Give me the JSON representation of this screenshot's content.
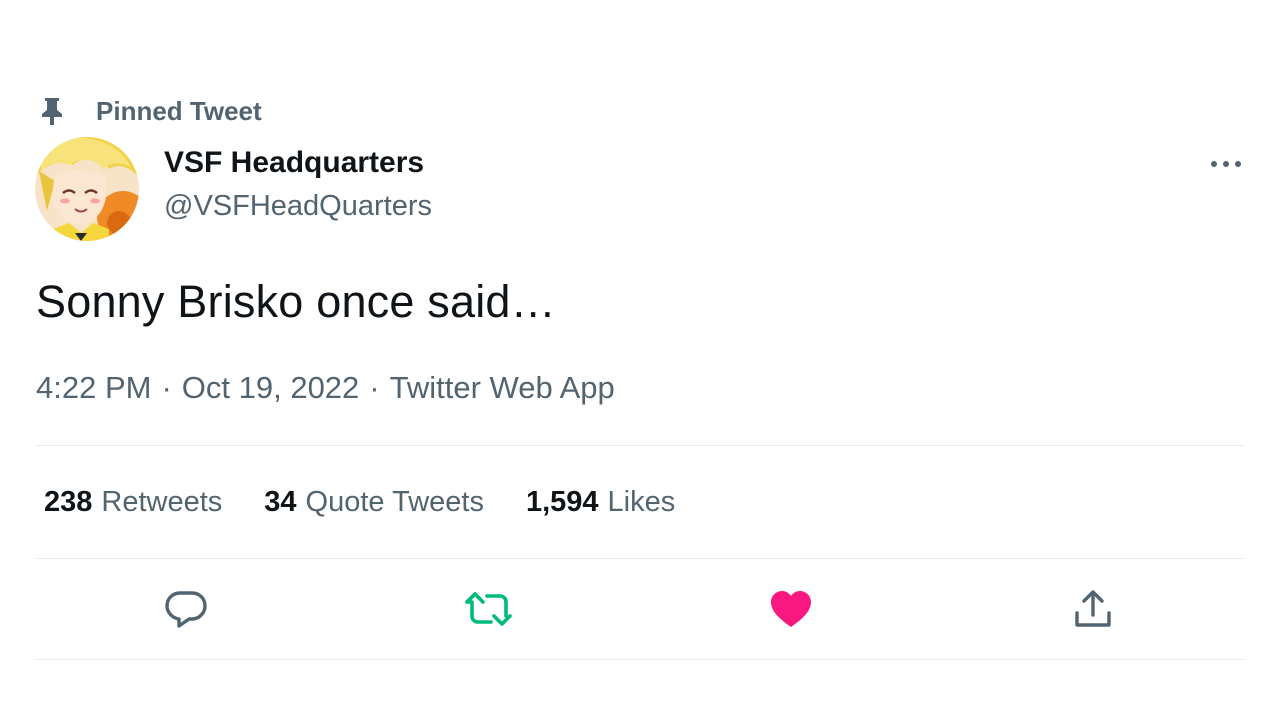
{
  "pinned": {
    "icon": "pin-icon",
    "label": "Pinned Tweet"
  },
  "author": {
    "display_name": "VSF Headquarters",
    "handle": "@VSFHeadQuarters",
    "avatar_icon": "avatar-image"
  },
  "more_icon": "more-icon",
  "tweet": {
    "text": "Sonny Brisko once said…",
    "time": "4:22 PM",
    "separator1": "·",
    "date": "Oct 19, 2022",
    "separator2": "·",
    "source": "Twitter Web App"
  },
  "stats": [
    {
      "count": "238",
      "label": "Retweets"
    },
    {
      "count": "34",
      "label": "Quote Tweets"
    },
    {
      "count": "1,594",
      "label": "Likes"
    }
  ],
  "actions": {
    "reply_icon": "reply-icon",
    "retweet_icon": "retweet-icon",
    "like_icon": "heart-icon",
    "share_icon": "share-icon"
  },
  "colors": {
    "text_primary": "#0f1419",
    "text_secondary": "#536471",
    "retweet_active": "#00ba7c",
    "like_active": "#f91880",
    "divider": "#e6ecf0"
  }
}
